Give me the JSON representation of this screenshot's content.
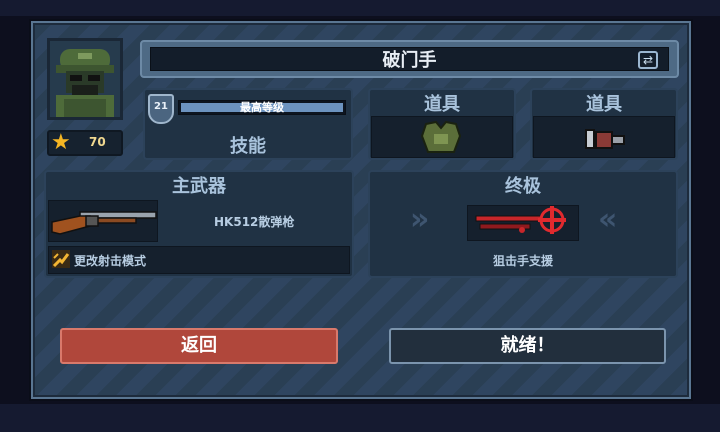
{
  "class_title": "破门手",
  "profile": {
    "stars": "70",
    "level": "21",
    "level_label": "最高等级",
    "level_progress": 1.0
  },
  "skill_label": "技能",
  "items": [
    {
      "label": "道具",
      "icon": "armor-vest-icon"
    },
    {
      "label": "道具",
      "icon": "ammo-clip-icon"
    }
  ],
  "primary_weapon": {
    "header": "主武器",
    "name": "HK512散弹枪",
    "fire_mode_label": "更改射击模式",
    "icon": "shotgun-icon"
  },
  "ultimate": {
    "header": "终极",
    "name": "狙击手支援",
    "icon": "sniper-rifle-icon"
  },
  "buttons": {
    "back": "返回",
    "ready": "就绪！"
  },
  "colors": {
    "back_button": "#b0473b",
    "star": "#f5b623",
    "panel": "#2a3f54"
  }
}
